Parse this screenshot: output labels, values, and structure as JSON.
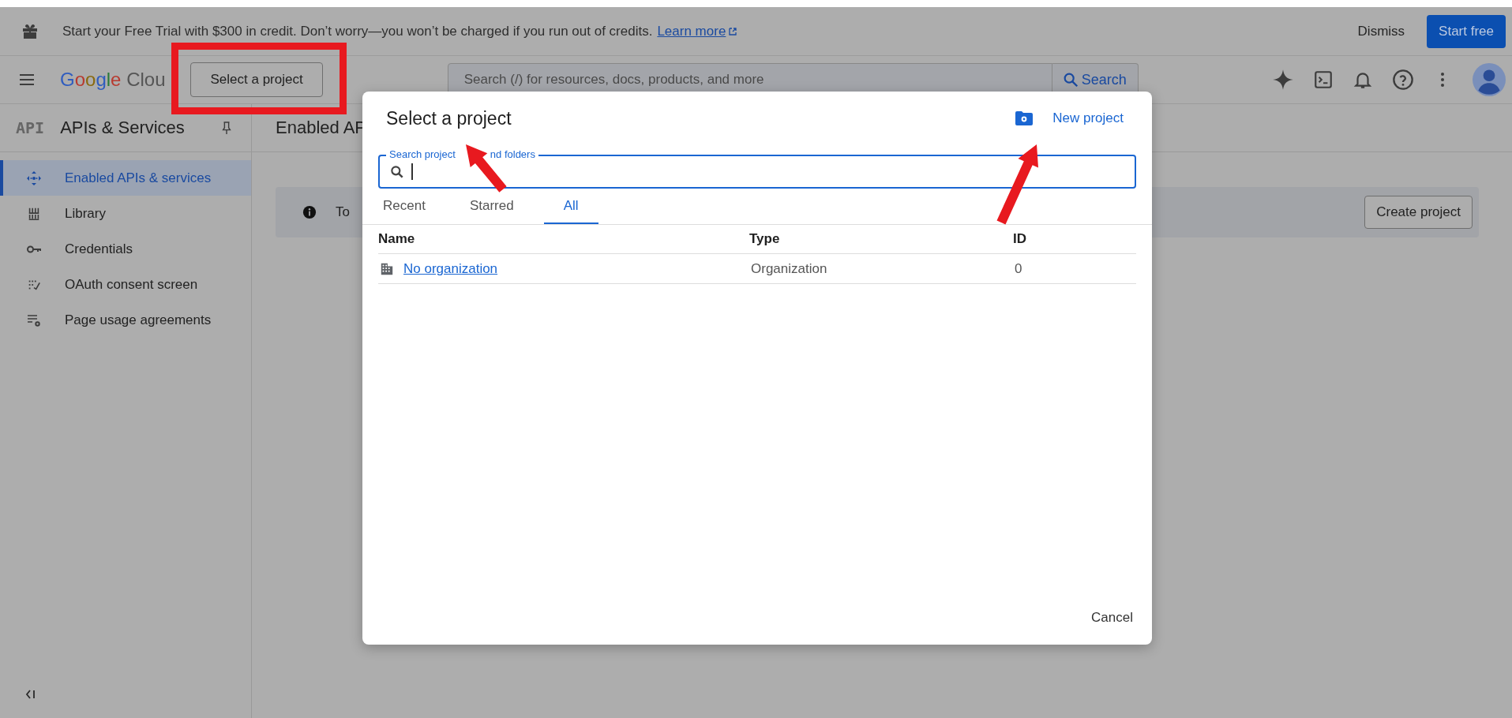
{
  "banner": {
    "text": "Start your Free Trial with $300 in credit. Don’t worry—you won’t be charged if you run out of credits.",
    "link": "Learn more",
    "dismiss": "Dismiss",
    "start": "Start free"
  },
  "header": {
    "logo": [
      "Google",
      "Clou"
    ],
    "project_button": "Select a project",
    "search_placeholder": "Search (/) for resources, docs, products, and more",
    "search_button": "Search"
  },
  "sidebar": {
    "logo": "API",
    "title": "APIs & Services",
    "items": [
      {
        "label": "Enabled APIs & services",
        "kind": "apis",
        "selected": true
      },
      {
        "label": "Library",
        "kind": "library",
        "selected": false
      },
      {
        "label": "Credentials",
        "kind": "key",
        "selected": false
      },
      {
        "label": "OAuth consent screen",
        "kind": "oauth",
        "selected": false
      },
      {
        "label": "Page usage agreements",
        "kind": "agreements",
        "selected": false
      }
    ]
  },
  "main": {
    "title": "Enabled AP",
    "info": "To",
    "create_button": "Create project"
  },
  "modal": {
    "title": "Select a project",
    "new_project": "New project",
    "search_label": [
      "Search project",
      "nd folders"
    ],
    "tabs": [
      {
        "label": "Recent",
        "selected": false
      },
      {
        "label": "Starred",
        "selected": false
      },
      {
        "label": "All",
        "selected": true
      }
    ],
    "columns": [
      "Name",
      "Type",
      "ID"
    ],
    "rows": [
      {
        "name": "No organization",
        "type": "Organization",
        "id": "0"
      }
    ],
    "cancel": "Cancel"
  },
  "annotations": [
    {
      "kind": "box"
    },
    {
      "kind": "arrow"
    },
    {
      "kind": "arrow"
    }
  ]
}
